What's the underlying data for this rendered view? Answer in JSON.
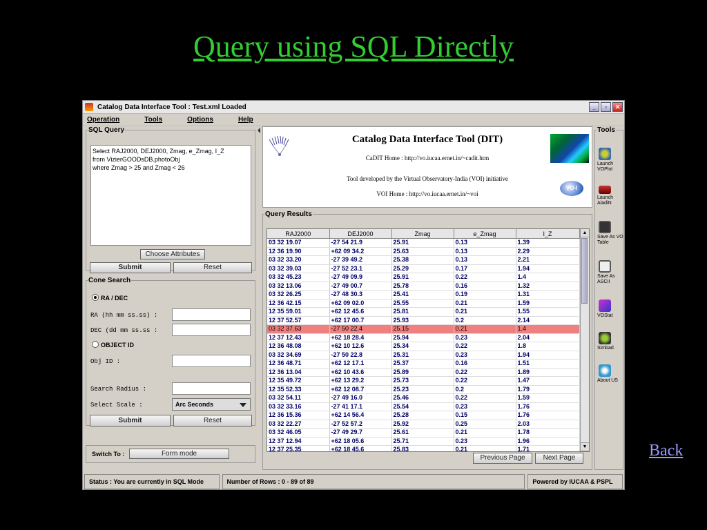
{
  "slide": {
    "title": "Query using SQL Directly",
    "back": "Back"
  },
  "window": {
    "title": "Catalog Data Interface Tool : Test.xml Loaded",
    "controls": [
      "_",
      "▫",
      "✕"
    ]
  },
  "menu": [
    "Operation",
    "Tools",
    "Options",
    "Help"
  ],
  "sql_panel": {
    "legend": "SQL Query",
    "query": "Select RAJ2000, DEJ2000, Zmag, e_Zmag, I_Z\nfrom VizierGOODsDB.photoObj\nwhere Zmag > 25 and Zmag < 26",
    "choose_attributes": "Choose Attributes",
    "submit": "Submit",
    "reset": "Reset"
  },
  "cone_search": {
    "legend": "Cone Search",
    "ra_dec_option": "RA / DEC",
    "ra_label": "RA (hh mm ss.ss) :",
    "dec_label": "DEC (dd mm ss.ss :",
    "object_id_option": "OBJECT ID",
    "obj_id_label": "Obj ID :",
    "search_radius_label": "Search Radius :",
    "select_scale_label": "Select Scale :",
    "scale_value": "Arc Seconds",
    "submit": "Submit",
    "reset": "Reset"
  },
  "switch": {
    "label": "Switch To :",
    "button": "Form mode"
  },
  "info": {
    "title": "Catalog Data Interface Tool (DIT)",
    "cadit_home": "CaDIT Home : http://vo.iucaa.ernet.in/~cadit.htm",
    "developed_by": "Tool developed by the Virtual Observatory-India (VOI) initiative",
    "voi_home": "VOI Home : http://vo.iucaa.ernet.in/~voi",
    "voi_logo": "VO-I"
  },
  "results": {
    "legend": "Query Results",
    "columns": [
      "RAJ2000",
      "DEJ2000",
      "Zmag",
      "e_Zmag",
      "I_Z"
    ],
    "rows": [
      [
        "03 32 19.07",
        "-27 54 21.9",
        "25.91",
        "0.13",
        "1.39"
      ],
      [
        "12 36 19.90",
        "+62 09 34.2",
        "25.63",
        "0.13",
        "2.29"
      ],
      [
        "03 32 33.20",
        "-27 39 49.2",
        "25.38",
        "0.13",
        "2.21"
      ],
      [
        "03 32 39.03",
        "-27 52 23.1",
        "25.29",
        "0.17",
        "1.94"
      ],
      [
        "03 32 45.23",
        "-27 49 09.9",
        "25.91",
        "0.22",
        "1.4"
      ],
      [
        "03 32 13.06",
        "-27 49 00.7",
        "25.78",
        "0.16",
        "1.32"
      ],
      [
        "03 32 26.25",
        "-27 48 30.3",
        "25.41",
        "0.19",
        "1.31"
      ],
      [
        "12 36 42.15",
        "+62 09 02.0",
        "25.55",
        "0.21",
        "1.59"
      ],
      [
        "12 35 59.01",
        "+62 12 45.6",
        "25.81",
        "0.21",
        "1.55"
      ],
      [
        "12 37 52.57",
        "+62 17 00.7",
        "25.93",
        "0.2",
        "2.14"
      ],
      [
        "03 32 37.63",
        "-27 50 22.4",
        "25.15",
        "0.21",
        "1.4"
      ],
      [
        "12 37 12.43",
        "+62 18 28.4",
        "25.94",
        "0.23",
        "2.04"
      ],
      [
        "12 36 48.08",
        "+62 10 12.6",
        "25.34",
        "0.22",
        "1.8"
      ],
      [
        "03 32 34.69",
        "-27 50 22.8",
        "25.31",
        "0.23",
        "1.94"
      ],
      [
        "12 36 48.71",
        "+62 12 17.1",
        "25.37",
        "0.16",
        "1.51"
      ],
      [
        "12 36 13.04",
        "+62 10 43.6",
        "25.89",
        "0.22",
        "1.89"
      ],
      [
        "12 35 49.72",
        "+62 13 29.2",
        "25.73",
        "0.22",
        "1.47"
      ],
      [
        "12 35 52.33",
        "+62 12 08.7",
        "25.23",
        "0.2",
        "1.79"
      ],
      [
        "03 32 54.11",
        "-27 49 16.0",
        "25.46",
        "0.22",
        "1.59"
      ],
      [
        "03 32 33.16",
        "-27 41 17.1",
        "25.54",
        "0.23",
        "1.76"
      ],
      [
        "12 36 15.36",
        "+62 14 56.4",
        "25.28",
        "0.15",
        "1.76"
      ],
      [
        "03 32 22.27",
        "-27 52 57.2",
        "25.92",
        "0.25",
        "2.03"
      ],
      [
        "03 32 46.05",
        "-27 49 29.7",
        "25.61",
        "0.21",
        "1.78"
      ],
      [
        "12 37 12.94",
        "+62 18 05.6",
        "25.71",
        "0.23",
        "1.96"
      ],
      [
        "12 37 25.35",
        "+62 18 45.6",
        "25.83",
        "0.21",
        "1.71"
      ]
    ],
    "selected_row": 10,
    "previous_page": "Previous Page",
    "next_page": "Next Page"
  },
  "tools": {
    "legend": "Tools",
    "items": [
      {
        "label": "Launch VOPlot",
        "icon": "voplot-icon"
      },
      {
        "label": "Launch AladiN",
        "icon": "aladin-icon"
      },
      {
        "label": "Save As VO Table",
        "icon": "floppy-disk-icon"
      },
      {
        "label": "Save As ASCII",
        "icon": "floppy-disk-icon"
      },
      {
        "label": "VOStat",
        "icon": "vostat-icon"
      },
      {
        "label": "Simbad",
        "icon": "simbad-icon"
      },
      {
        "label": "About US",
        "icon": "about-icon"
      }
    ]
  },
  "status": {
    "status_text": "Status :    You are currently in SQL Mode",
    "rows_text": "Number of Rows :   0 - 89 of 89",
    "powered": "Powered by IUCAA & PSPL"
  },
  "colors": {
    "title_green": "#33cc33",
    "selected_row": "#f08080",
    "link_blue": "#9999ff"
  }
}
